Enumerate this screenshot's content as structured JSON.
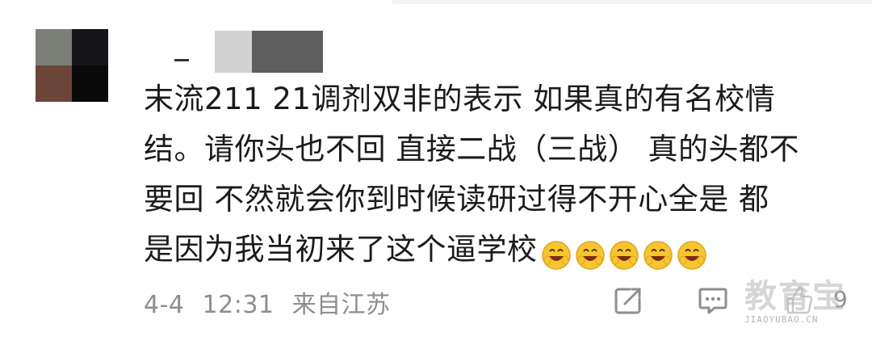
{
  "comment": {
    "lines": [
      "末流211 21调剂双非的表示 如果真的有名校情",
      "结。请你头也不回 直接二战（三战） 真的头都不",
      "要回 不然就会你到时候读研过得不开心全是 都",
      "是因为我当初来了这个逼学校"
    ],
    "emoji": [
      "grinning-face-emoji",
      "grinning-face-emoji",
      "grinning-face-emoji",
      "grinning-face-emoji",
      "grinning-face-emoji"
    ]
  },
  "meta": {
    "date": "4-4",
    "time": "12:31",
    "location": "来自江苏"
  },
  "actions": {
    "share_icon": "share-icon",
    "comment_icon": "comment-icon",
    "like_count": "9"
  },
  "watermark": {
    "main": "教育宝",
    "sub": "JIAOYUBAO.CN"
  },
  "colors": {
    "text": "#1b1b1b",
    "meta": "#8e8e8e",
    "emoji_face": "#f7c531"
  }
}
